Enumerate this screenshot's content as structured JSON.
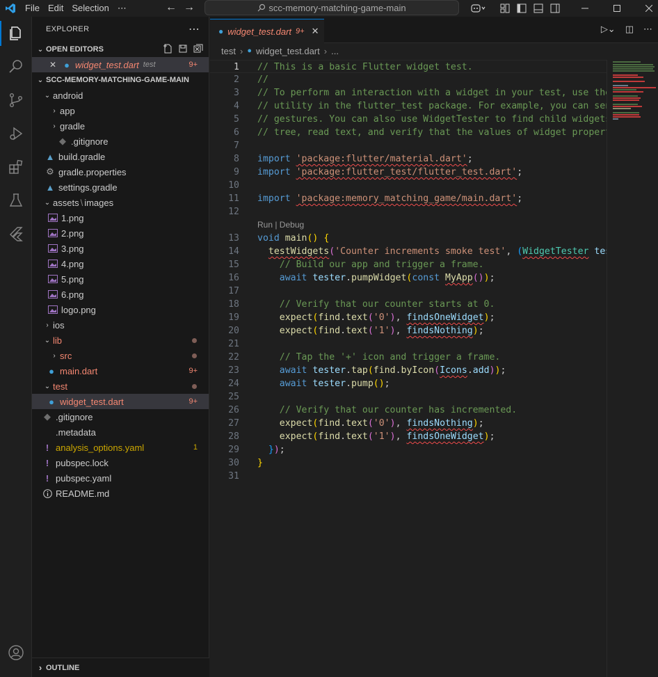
{
  "titlebar": {
    "menus": [
      "File",
      "Edit",
      "Selection",
      "⋯"
    ],
    "search_text": "scc-memory-matching-game-main"
  },
  "sidebar": {
    "title": "EXPLORER",
    "open_editors_label": "OPEN EDITORS",
    "open_editor": {
      "name": "widget_test.dart",
      "folder": "test",
      "badge": "9+"
    },
    "project_label": "SCC-MEMORY-MATCHING-GAME-MAIN",
    "tree": {
      "android": "android",
      "app": "app",
      "gradle": "gradle",
      "android_gitignore": ".gitignore",
      "build_gradle": "build.gradle",
      "gradle_properties": "gradle.properties",
      "settings_gradle": "settings.gradle",
      "assets_folder": "assets",
      "images_folder": "images",
      "images": [
        "1.png",
        "2.png",
        "3.png",
        "4.png",
        "5.png",
        "6.png",
        "logo.png"
      ],
      "ios": "ios",
      "lib": "lib",
      "src": "src",
      "main_dart": "main.dart",
      "main_badge": "9+",
      "test": "test",
      "widget_test": "widget_test.dart",
      "widget_badge": "9+",
      "root_gitignore": ".gitignore",
      "metadata": ".metadata",
      "analysis": "analysis_options.yaml",
      "analysis_badge": "1",
      "pubspec_lock": "pubspec.lock",
      "pubspec_yaml": "pubspec.yaml",
      "readme": "README.md"
    },
    "outline_label": "OUTLINE"
  },
  "editor": {
    "tab": {
      "name": "widget_test.dart",
      "badge": "9+"
    },
    "breadcrumb": [
      "test",
      "widget_test.dart",
      "..."
    ],
    "codelens": "Run | Debug",
    "line_numbers": [
      "1",
      "2",
      "3",
      "4",
      "5",
      "6",
      "7",
      "8",
      "9",
      "10",
      "11",
      "12",
      "13",
      "14",
      "15",
      "16",
      "17",
      "18",
      "19",
      "20",
      "21",
      "22",
      "23",
      "24",
      "25",
      "26",
      "27",
      "28",
      "29",
      "30",
      "31"
    ]
  },
  "colors": {
    "accent": "#0078d4",
    "error": "#f48771",
    "warning": "#cca700"
  },
  "icons": [
    "vscode-logo-icon",
    "files-icon",
    "search-icon",
    "source-control-icon",
    "run-debug-icon",
    "extensions-icon",
    "testing-icon",
    "flutter-icon",
    "account-icon",
    "copilot-icon",
    "layout-icon",
    "dart-file-icon",
    "image-file-icon",
    "gradle-icon",
    "gear-icon",
    "info-icon",
    "yaml-icon"
  ]
}
